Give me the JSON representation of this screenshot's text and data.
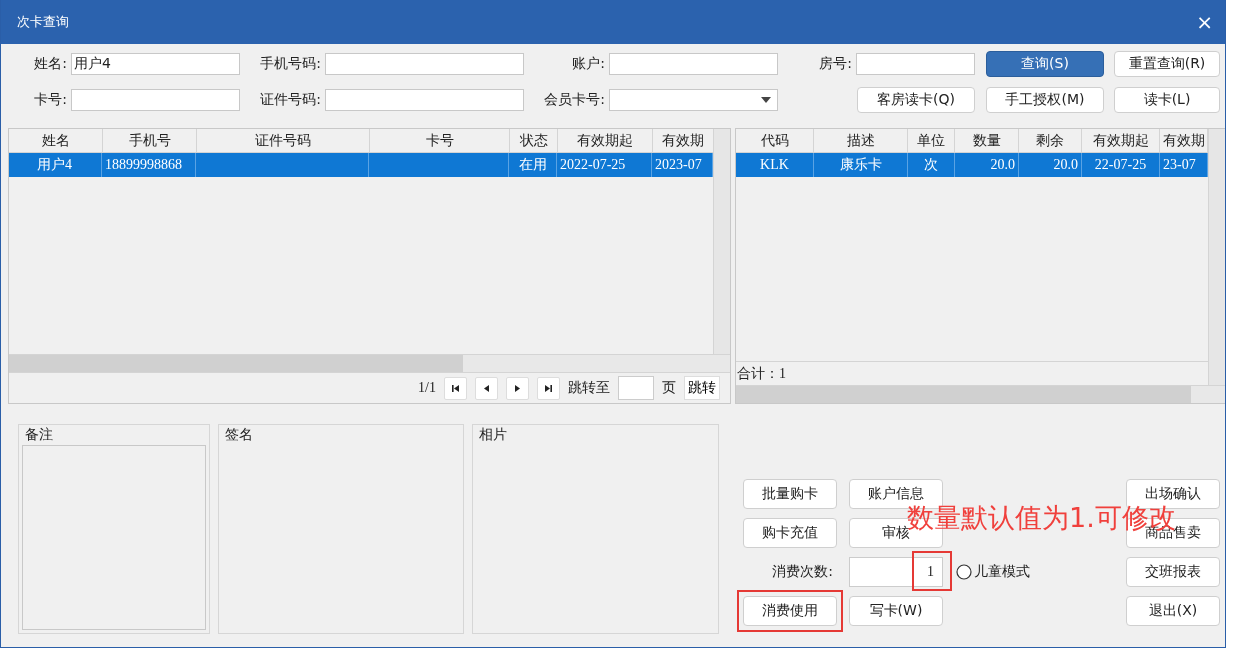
{
  "window": {
    "title": "次卡查询",
    "close": "×"
  },
  "search": {
    "rows": [
      [
        {
          "label": "姓名:",
          "kind": "text",
          "value": "用户4"
        },
        {
          "label": "手机号码:",
          "kind": "text"
        },
        {
          "label": "账户:",
          "kind": "text"
        },
        {
          "label": "房号:",
          "kind": "text"
        }
      ],
      [
        {
          "label": "卡号:",
          "kind": "text"
        },
        {
          "label": "证件号码:",
          "kind": "text"
        },
        {
          "label": "会员卡号:",
          "kind": "select"
        }
      ]
    ],
    "buttons": [
      [
        {
          "label": "查询(S)",
          "default": true
        },
        {
          "label": "重置查询(R)",
          "default": false
        }
      ],
      [
        {
          "label": "客房读卡(Q)",
          "default": false
        },
        {
          "label": "手工授权(M)",
          "default": false
        },
        {
          "label": "读卡(L)",
          "default": false
        }
      ]
    ]
  },
  "cards_table": {
    "columns": [
      "姓名",
      "手机号",
      "证件号码",
      "卡号",
      "状态",
      "有效期起",
      "有效期"
    ],
    "rows": [
      {
        "cells": [
          "用户4",
          "18899998868",
          "",
          "",
          "在用",
          "2022-07-25",
          "2023-07"
        ],
        "selected": true
      }
    ],
    "pager": {
      "page": "1/1",
      "jump_label": "跳转至",
      "page_unit": "页",
      "jump_button": "跳转"
    }
  },
  "items_table": {
    "columns": [
      "代码",
      "描述",
      "单位",
      "数量",
      "剩余",
      "有效期起",
      "有效期"
    ],
    "rows": [
      {
        "cells": [
          "KLK",
          "康乐卡",
          "次",
          "20.0",
          "20.0",
          "22-07-25",
          "23-07"
        ],
        "selected": true
      }
    ],
    "total": "合计：1"
  },
  "panels": [
    {
      "title": "备注",
      "kind": "textarea"
    },
    {
      "title": "签名",
      "kind": "picture-area"
    },
    {
      "title": "相片",
      "kind": "picture-area"
    }
  ],
  "actions": {
    "left_buttons": [
      {
        "label": "批量购卡"
      },
      {
        "label": "账户信息"
      },
      {
        "label": "购卡充值"
      },
      {
        "label": "审核"
      }
    ],
    "count": {
      "label": "消费次数:",
      "value": "1",
      "highlighted": true
    },
    "child_mode": {
      "label": "儿童模式",
      "checked": false
    },
    "bottom_buttons": [
      {
        "label": "消费使用",
        "highlighted": true
      },
      {
        "label": "写卡(W)",
        "highlighted": false
      }
    ],
    "right_buttons": [
      {
        "label": "出场确认"
      },
      {
        "label": "商品售卖"
      },
      {
        "label": "交班报表"
      },
      {
        "label": "退出(X)"
      }
    ]
  },
  "annotation": {
    "text": "数量默认值为1.可修改"
  }
}
